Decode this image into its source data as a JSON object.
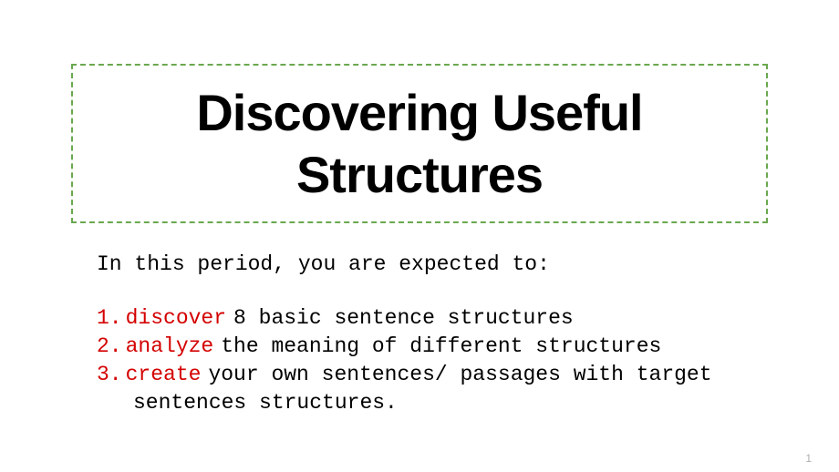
{
  "title": "Discovering Useful Structures",
  "intro": "In this period, you are expected to:",
  "items": [
    {
      "number": "1.",
      "keyword": "discover",
      "rest": "8 basic sentence structures"
    },
    {
      "number": "2.",
      "keyword": "analyze",
      "rest": "the meaning of different structures"
    },
    {
      "number": "3.",
      "keyword": "create",
      "rest": "your own sentences/ passages with target",
      "continuation": "sentences structures."
    }
  ],
  "pageNumber": "1",
  "colors": {
    "border": "#6aa84f",
    "highlight": "#d40000",
    "text": "#000000"
  }
}
